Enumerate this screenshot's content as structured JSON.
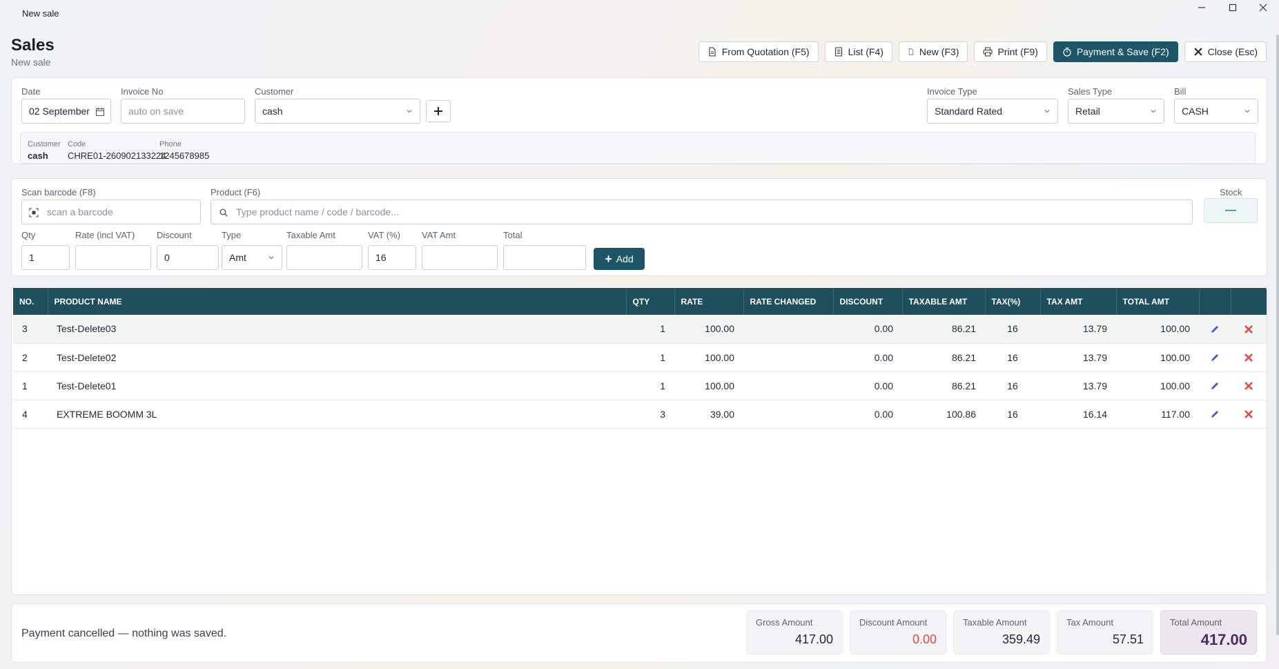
{
  "window": {
    "title": "New sale"
  },
  "page": {
    "title": "Sales",
    "subtitle": "New sale"
  },
  "toolbar": {
    "from_quotation": "From Quotation (F5)",
    "list": "List (F4)",
    "new": "New (F3)",
    "print": "Print (F9)",
    "payment_save": "Payment & Save (F2)",
    "close": "Close (Esc)"
  },
  "header": {
    "date_label": "Date",
    "date_value": "02 September",
    "invoice_label": "Invoice No",
    "invoice_placeholder": "auto on save",
    "customer_label": "Customer",
    "customer_value": "cash",
    "invoice_type_label": "Invoice Type",
    "invoice_type_value": "Standard Rated",
    "sales_type_label": "Sales Type",
    "sales_type_value": "Retail",
    "bill_label": "Bill",
    "bill_value": "CASH"
  },
  "customer_info": {
    "customer_label": "Customer",
    "customer_value": "cash",
    "code_label": "Code",
    "code_value": "CHRE01-260902133224",
    "phone_label": "Phone",
    "phone_value": "1245678985"
  },
  "entry": {
    "barcode_label": "Scan barcode (F8)",
    "barcode_placeholder": "scan a barcode",
    "product_label": "Product (F6)",
    "product_placeholder": "Type product name / code / barcode...",
    "stock_label": "Stock",
    "stock_value": "—",
    "qty_label": "Qty",
    "qty_value": "1",
    "rate_label": "Rate (incl VAT)",
    "rate_value": "",
    "discount_label": "Discount",
    "discount_value": "0",
    "type_label": "Type",
    "type_value": "Amt",
    "taxable_label": "Taxable Amt",
    "taxable_value": "",
    "vat_label": "VAT (%)",
    "vat_value": "16",
    "vat_amt_label": "VAT Amt",
    "vat_amt_value": "",
    "total_label": "Total",
    "total_value": "",
    "add_label": "Add"
  },
  "table": {
    "headers": [
      "NO.",
      "PRODUCT NAME",
      "QTY",
      "RATE",
      "RATE CHANGED",
      "DISCOUNT",
      "TAXABLE AMT",
      "TAX(%)",
      "TAX AMT",
      "TOTAL AMT"
    ],
    "rows": [
      {
        "no": "3",
        "name": "Test-Delete03",
        "qty": "1",
        "rate": "100.00",
        "rate_changed": "",
        "discount": "0.00",
        "taxable": "86.21",
        "tax_pct": "16",
        "tax_amt": "13.79",
        "total": "100.00"
      },
      {
        "no": "2",
        "name": "Test-Delete02",
        "qty": "1",
        "rate": "100.00",
        "rate_changed": "",
        "discount": "0.00",
        "taxable": "86.21",
        "tax_pct": "16",
        "tax_amt": "13.79",
        "total": "100.00"
      },
      {
        "no": "1",
        "name": "Test-Delete01",
        "qty": "1",
        "rate": "100.00",
        "rate_changed": "",
        "discount": "0.00",
        "taxable": "86.21",
        "tax_pct": "16",
        "tax_amt": "13.79",
        "total": "100.00"
      },
      {
        "no": "4",
        "name": "EXTREME BOOMM 3L",
        "qty": "3",
        "rate": "39.00",
        "rate_changed": "",
        "discount": "0.00",
        "taxable": "100.86",
        "tax_pct": "16",
        "tax_amt": "16.14",
        "total": "117.00"
      }
    ]
  },
  "footer": {
    "status": "Payment cancelled — nothing was saved.",
    "gross_label": "Gross Amount",
    "gross_value": "417.00",
    "discount_label": "Discount Amount",
    "discount_value": "0.00",
    "taxable_label": "Taxable Amount",
    "taxable_value": "359.49",
    "tax_label": "Tax Amount",
    "tax_value": "57.51",
    "total_label": "Total Amount",
    "total_value": "417.00"
  },
  "colors": {
    "accent": "#1d5566",
    "table_header": "#1d4f5c",
    "danger": "#e04a4a",
    "total_text": "#4d2a63"
  },
  "icons": [
    "document-icon",
    "list-icon",
    "new-doc-icon",
    "printer-icon",
    "payment-icon",
    "close-icon",
    "calendar-icon",
    "chevron-down-icon",
    "plus-icon",
    "barcode-scan-icon",
    "search-icon",
    "edit-icon",
    "delete-icon"
  ]
}
